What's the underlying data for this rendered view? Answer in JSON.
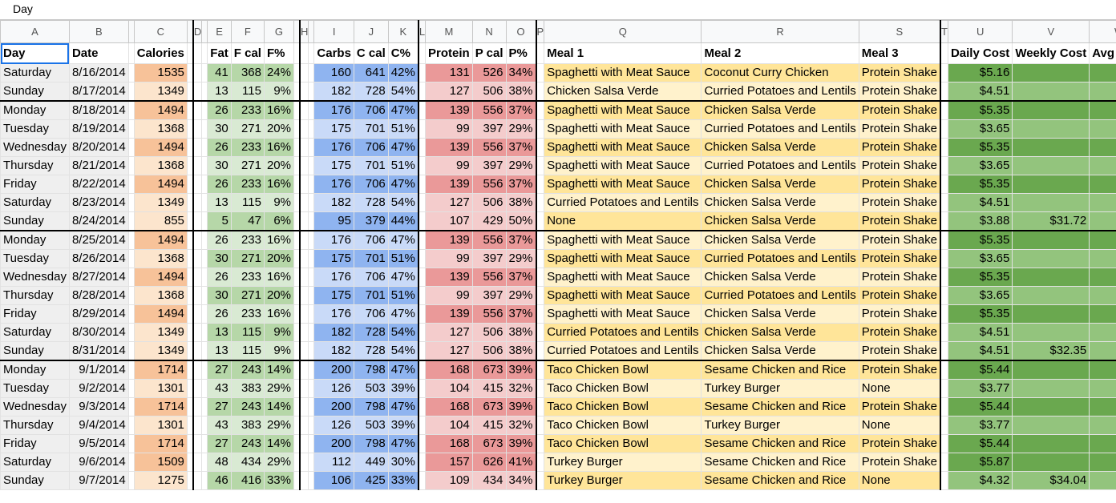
{
  "formula_bar": {
    "value": "Day"
  },
  "column_letters": [
    "A",
    "B",
    "C",
    "D",
    "E",
    "F",
    "G",
    "H",
    "I",
    "J",
    "K",
    "L",
    "M",
    "N",
    "O",
    "P",
    "Q",
    "R",
    "S",
    "T",
    "U",
    "V",
    "W"
  ],
  "headers": {
    "day": "Day",
    "date": "Date",
    "calories": "Calories",
    "fat": "Fat",
    "fcal": "F cal",
    "fpct": "F%",
    "carbs": "Carbs",
    "ccal": "C cal",
    "cpct": "C%",
    "protein": "Protein",
    "pcal": "P cal",
    "ppct": "P%",
    "meal1": "Meal 1",
    "meal2": "Meal 2",
    "meal3": "Meal 3",
    "daily_cost": "Daily Cost",
    "weekly_cost": "Weekly Cost",
    "avg_daily": "Avg Daily"
  },
  "rows": [
    {
      "day": "Saturday",
      "date": "8/16/2014",
      "calories": "1535",
      "fat": "41",
      "fcal": "368",
      "fpct": "24%",
      "carbs": "160",
      "ccal": "641",
      "cpct": "42%",
      "protein": "131",
      "pcal": "526",
      "ppct": "34%",
      "meal1": "Spaghetti with Meat Sauce",
      "meal2": "Coconut Curry Chicken",
      "meal3": "Protein Shake",
      "daily": "$5.16",
      "weekly": "",
      "avg": ""
    },
    {
      "day": "Sunday",
      "date": "8/17/2014",
      "calories": "1349",
      "fat": "13",
      "fcal": "115",
      "fpct": "9%",
      "carbs": "182",
      "ccal": "728",
      "cpct": "54%",
      "protein": "127",
      "pcal": "506",
      "ppct": "38%",
      "meal1": "Chicken Salsa Verde",
      "meal2": "Curried Potatoes and Lentils",
      "meal3": "Protein Shake",
      "daily": "$4.51",
      "weekly": "",
      "avg": ""
    },
    {
      "day": "Monday",
      "date": "8/18/2014",
      "calories": "1494",
      "fat": "26",
      "fcal": "233",
      "fpct": "16%",
      "carbs": "176",
      "ccal": "706",
      "cpct": "47%",
      "protein": "139",
      "pcal": "556",
      "ppct": "37%",
      "meal1": "Spaghetti with Meat Sauce",
      "meal2": "Chicken Salsa Verde",
      "meal3": "Protein Shake",
      "daily": "$5.35",
      "weekly": "",
      "avg": ""
    },
    {
      "day": "Tuesday",
      "date": "8/19/2014",
      "calories": "1368",
      "fat": "30",
      "fcal": "271",
      "fpct": "20%",
      "carbs": "175",
      "ccal": "701",
      "cpct": "51%",
      "protein": "99",
      "pcal": "397",
      "ppct": "29%",
      "meal1": "Spaghetti with Meat Sauce",
      "meal2": "Curried Potatoes and Lentils",
      "meal3": "Protein Shake",
      "daily": "$3.65",
      "weekly": "",
      "avg": ""
    },
    {
      "day": "Wednesday",
      "date": "8/20/2014",
      "calories": "1494",
      "fat": "26",
      "fcal": "233",
      "fpct": "16%",
      "carbs": "176",
      "ccal": "706",
      "cpct": "47%",
      "protein": "139",
      "pcal": "556",
      "ppct": "37%",
      "meal1": "Spaghetti with Meat Sauce",
      "meal2": "Chicken Salsa Verde",
      "meal3": "Protein Shake",
      "daily": "$5.35",
      "weekly": "",
      "avg": ""
    },
    {
      "day": "Thursday",
      "date": "8/21/2014",
      "calories": "1368",
      "fat": "30",
      "fcal": "271",
      "fpct": "20%",
      "carbs": "175",
      "ccal": "701",
      "cpct": "51%",
      "protein": "99",
      "pcal": "397",
      "ppct": "29%",
      "meal1": "Spaghetti with Meat Sauce",
      "meal2": "Curried Potatoes and Lentils",
      "meal3": "Protein Shake",
      "daily": "$3.65",
      "weekly": "",
      "avg": ""
    },
    {
      "day": "Friday",
      "date": "8/22/2014",
      "calories": "1494",
      "fat": "26",
      "fcal": "233",
      "fpct": "16%",
      "carbs": "176",
      "ccal": "706",
      "cpct": "47%",
      "protein": "139",
      "pcal": "556",
      "ppct": "37%",
      "meal1": "Spaghetti with Meat Sauce",
      "meal2": "Chicken Salsa Verde",
      "meal3": "Protein Shake",
      "daily": "$5.35",
      "weekly": "",
      "avg": ""
    },
    {
      "day": "Saturday",
      "date": "8/23/2014",
      "calories": "1349",
      "fat": "13",
      "fcal": "115",
      "fpct": "9%",
      "carbs": "182",
      "ccal": "728",
      "cpct": "54%",
      "protein": "127",
      "pcal": "506",
      "ppct": "38%",
      "meal1": "Curried Potatoes and Lentils",
      "meal2": "Chicken Salsa Verde",
      "meal3": "Protein Shake",
      "daily": "$4.51",
      "weekly": "",
      "avg": ""
    },
    {
      "day": "Sunday",
      "date": "8/24/2014",
      "calories": "855",
      "fat": "5",
      "fcal": "47",
      "fpct": "6%",
      "carbs": "95",
      "ccal": "379",
      "cpct": "44%",
      "protein": "107",
      "pcal": "429",
      "ppct": "50%",
      "meal1": "None",
      "meal2": "Chicken Salsa Verde",
      "meal3": "Protein Shake",
      "daily": "$3.88",
      "weekly": "$31.72",
      "avg": ""
    },
    {
      "day": "Monday",
      "date": "8/25/2014",
      "calories": "1494",
      "fat": "26",
      "fcal": "233",
      "fpct": "16%",
      "carbs": "176",
      "ccal": "706",
      "cpct": "47%",
      "protein": "139",
      "pcal": "556",
      "ppct": "37%",
      "meal1": "Spaghetti with Meat Sauce",
      "meal2": "Chicken Salsa Verde",
      "meal3": "Protein Shake",
      "daily": "$5.35",
      "weekly": "",
      "avg": ""
    },
    {
      "day": "Tuesday",
      "date": "8/26/2014",
      "calories": "1368",
      "fat": "30",
      "fcal": "271",
      "fpct": "20%",
      "carbs": "175",
      "ccal": "701",
      "cpct": "51%",
      "protein": "99",
      "pcal": "397",
      "ppct": "29%",
      "meal1": "Spaghetti with Meat Sauce",
      "meal2": "Curried Potatoes and Lentils",
      "meal3": "Protein Shake",
      "daily": "$3.65",
      "weekly": "",
      "avg": ""
    },
    {
      "day": "Wednesday",
      "date": "8/27/2014",
      "calories": "1494",
      "fat": "26",
      "fcal": "233",
      "fpct": "16%",
      "carbs": "176",
      "ccal": "706",
      "cpct": "47%",
      "protein": "139",
      "pcal": "556",
      "ppct": "37%",
      "meal1": "Spaghetti with Meat Sauce",
      "meal2": "Chicken Salsa Verde",
      "meal3": "Protein Shake",
      "daily": "$5.35",
      "weekly": "",
      "avg": ""
    },
    {
      "day": "Thursday",
      "date": "8/28/2014",
      "calories": "1368",
      "fat": "30",
      "fcal": "271",
      "fpct": "20%",
      "carbs": "175",
      "ccal": "701",
      "cpct": "51%",
      "protein": "99",
      "pcal": "397",
      "ppct": "29%",
      "meal1": "Spaghetti with Meat Sauce",
      "meal2": "Curried Potatoes and Lentils",
      "meal3": "Protein Shake",
      "daily": "$3.65",
      "weekly": "",
      "avg": ""
    },
    {
      "day": "Friday",
      "date": "8/29/2014",
      "calories": "1494",
      "fat": "26",
      "fcal": "233",
      "fpct": "16%",
      "carbs": "176",
      "ccal": "706",
      "cpct": "47%",
      "protein": "139",
      "pcal": "556",
      "ppct": "37%",
      "meal1": "Spaghetti with Meat Sauce",
      "meal2": "Chicken Salsa Verde",
      "meal3": "Protein Shake",
      "daily": "$5.35",
      "weekly": "",
      "avg": ""
    },
    {
      "day": "Saturday",
      "date": "8/30/2014",
      "calories": "1349",
      "fat": "13",
      "fcal": "115",
      "fpct": "9%",
      "carbs": "182",
      "ccal": "728",
      "cpct": "54%",
      "protein": "127",
      "pcal": "506",
      "ppct": "38%",
      "meal1": "Curried Potatoes and Lentils",
      "meal2": "Chicken Salsa Verde",
      "meal3": "Protein Shake",
      "daily": "$4.51",
      "weekly": "",
      "avg": ""
    },
    {
      "day": "Sunday",
      "date": "8/31/2014",
      "calories": "1349",
      "fat": "13",
      "fcal": "115",
      "fpct": "9%",
      "carbs": "182",
      "ccal": "728",
      "cpct": "54%",
      "protein": "127",
      "pcal": "506",
      "ppct": "38%",
      "meal1": "Curried Potatoes and Lentils",
      "meal2": "Chicken Salsa Verde",
      "meal3": "Protein Shake",
      "daily": "$4.51",
      "weekly": "$32.35",
      "avg": ""
    },
    {
      "day": "Monday",
      "date": "9/1/2014",
      "calories": "1714",
      "fat": "27",
      "fcal": "243",
      "fpct": "14%",
      "carbs": "200",
      "ccal": "798",
      "cpct": "47%",
      "protein": "168",
      "pcal": "673",
      "ppct": "39%",
      "meal1": "Taco Chicken Bowl",
      "meal2": "Sesame Chicken and Rice",
      "meal3": "Protein Shake",
      "daily": "$5.44",
      "weekly": "",
      "avg": ""
    },
    {
      "day": "Tuesday",
      "date": "9/2/2014",
      "calories": "1301",
      "fat": "43",
      "fcal": "383",
      "fpct": "29%",
      "carbs": "126",
      "ccal": "503",
      "cpct": "39%",
      "protein": "104",
      "pcal": "415",
      "ppct": "32%",
      "meal1": "Taco Chicken Bowl",
      "meal2": "Turkey Burger",
      "meal3": "None",
      "daily": "$3.77",
      "weekly": "",
      "avg": ""
    },
    {
      "day": "Wednesday",
      "date": "9/3/2014",
      "calories": "1714",
      "fat": "27",
      "fcal": "243",
      "fpct": "14%",
      "carbs": "200",
      "ccal": "798",
      "cpct": "47%",
      "protein": "168",
      "pcal": "673",
      "ppct": "39%",
      "meal1": "Taco Chicken Bowl",
      "meal2": "Sesame Chicken and Rice",
      "meal3": "Protein Shake",
      "daily": "$5.44",
      "weekly": "",
      "avg": ""
    },
    {
      "day": "Thursday",
      "date": "9/4/2014",
      "calories": "1301",
      "fat": "43",
      "fcal": "383",
      "fpct": "29%",
      "carbs": "126",
      "ccal": "503",
      "cpct": "39%",
      "protein": "104",
      "pcal": "415",
      "ppct": "32%",
      "meal1": "Taco Chicken Bowl",
      "meal2": "Turkey Burger",
      "meal3": "None",
      "daily": "$3.77",
      "weekly": "",
      "avg": ""
    },
    {
      "day": "Friday",
      "date": "9/5/2014",
      "calories": "1714",
      "fat": "27",
      "fcal": "243",
      "fpct": "14%",
      "carbs": "200",
      "ccal": "798",
      "cpct": "47%",
      "protein": "168",
      "pcal": "673",
      "ppct": "39%",
      "meal1": "Taco Chicken Bowl",
      "meal2": "Sesame Chicken and Rice",
      "meal3": "Protein Shake",
      "daily": "$5.44",
      "weekly": "",
      "avg": ""
    },
    {
      "day": "Saturday",
      "date": "9/6/2014",
      "calories": "1509",
      "fat": "48",
      "fcal": "434",
      "fpct": "29%",
      "carbs": "112",
      "ccal": "449",
      "cpct": "30%",
      "protein": "157",
      "pcal": "626",
      "ppct": "41%",
      "meal1": "Turkey Burger",
      "meal2": "Sesame Chicken and Rice",
      "meal3": "Protein Shake",
      "daily": "$5.87",
      "weekly": "",
      "avg": ""
    },
    {
      "day": "Sunday",
      "date": "9/7/2014",
      "calories": "1275",
      "fat": "46",
      "fcal": "416",
      "fpct": "33%",
      "carbs": "106",
      "ccal": "425",
      "cpct": "33%",
      "protein": "109",
      "pcal": "434",
      "ppct": "34%",
      "meal1": "Turkey Burger",
      "meal2": "Sesame Chicken and Rice",
      "meal3": "None",
      "daily": "$4.32",
      "weekly": "$34.04",
      "avg": ""
    }
  ]
}
